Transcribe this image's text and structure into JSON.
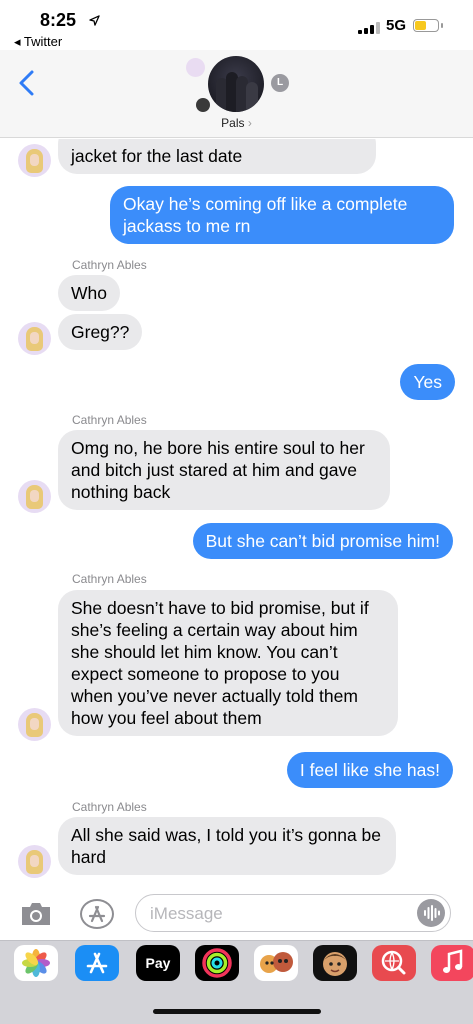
{
  "status_bar": {
    "time": "8:25",
    "back_app": "◂ Twitter",
    "network": "5G"
  },
  "header": {
    "group_name": "Pals",
    "group_chevron": "›",
    "member_initial": "L"
  },
  "thread": {
    "messages": [
      {
        "kind": "in",
        "text": "jacket for the last date"
      },
      {
        "kind": "out",
        "text": "Okay he’s coming off like a complete jackass to me rn"
      },
      {
        "kind": "sender",
        "text": "Cathryn Ables"
      },
      {
        "kind": "in",
        "text": "Who"
      },
      {
        "kind": "in",
        "text": "Greg??"
      },
      {
        "kind": "out",
        "text": "Yes"
      },
      {
        "kind": "sender",
        "text": "Cathryn Ables"
      },
      {
        "kind": "in",
        "text": "Omg no, he bore his entire soul to her and bitch just stared at him and gave nothing back"
      },
      {
        "kind": "out",
        "text": "But she can’t bid promise him!"
      },
      {
        "kind": "sender",
        "text": "Cathryn Ables"
      },
      {
        "kind": "in",
        "text": "She doesn’t have to bid promise, but if she’s feeling a certain way about him she should let him know. You can’t expect someone to propose to you when you’ve never actually told them how you feel about them"
      },
      {
        "kind": "out",
        "text": "I feel like she has!"
      },
      {
        "kind": "sender",
        "text": "Cathryn Ables"
      },
      {
        "kind": "in",
        "text": "All she said was, I told you it’s gonna be hard"
      }
    ]
  },
  "input": {
    "placeholder": "iMessage"
  },
  "app_strip": {
    "apple_pay_label": "Pay",
    "icons": [
      "photos-icon",
      "app-store-icon",
      "apple-pay-icon",
      "activity-icon",
      "memoji-icon",
      "memoji-stickers-icon",
      "web-search-icon",
      "music-icon"
    ]
  },
  "colors": {
    "outgoing_bubble": "#3b8dfa",
    "incoming_bubble": "#e9e9eb",
    "sender_name": "#8a8a8e",
    "accent": "#2f7cf6"
  }
}
